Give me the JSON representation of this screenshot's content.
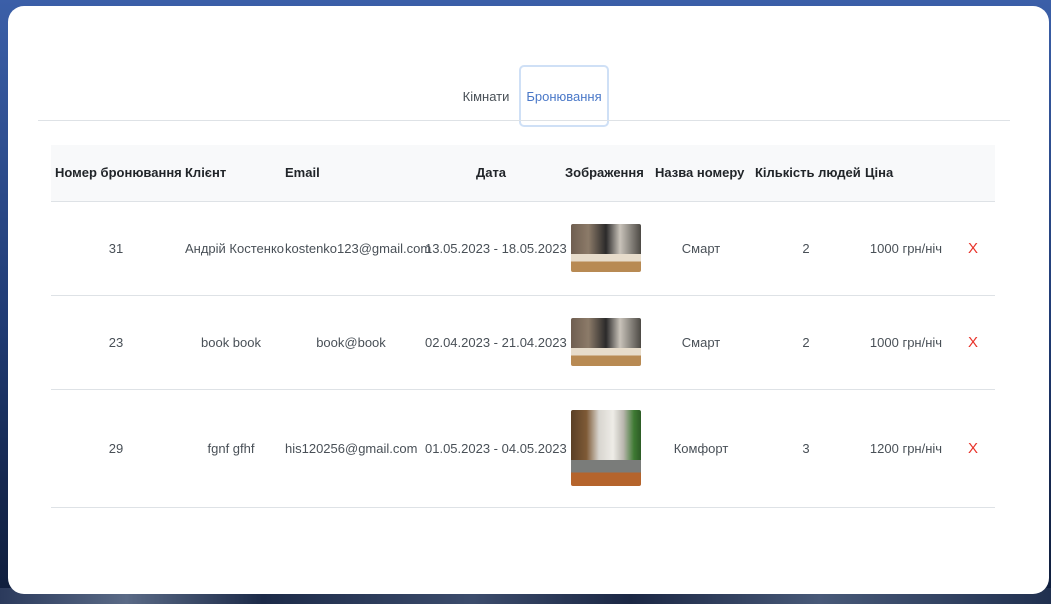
{
  "tabs": [
    {
      "label": "Кімнати",
      "active": false
    },
    {
      "label": "Бронювання",
      "active": true
    }
  ],
  "table": {
    "headers": [
      "Номер бронювання",
      "Клієнт",
      "Email",
      "Дата",
      "Зображення",
      "Назва номеру",
      "Кількість людей",
      "Ціна"
    ],
    "rows": [
      {
        "id": "31",
        "client": "Андрій Костенко",
        "email": "kostenko123@gmail.com",
        "date": "13.05.2023 - 18.05.2023",
        "room": "Смарт",
        "people": "2",
        "price": "1000 грн/ніч",
        "delete": "X"
      },
      {
        "id": "23",
        "client": "book book",
        "email": "book@book",
        "date": "02.04.2023 - 21.04.2023",
        "room": "Смарт",
        "people": "2",
        "price": "1000 грн/ніч",
        "delete": "X"
      },
      {
        "id": "29",
        "client": "fgnf gfhf",
        "email": "his120256@gmail.com",
        "date": "01.05.2023 - 04.05.2023",
        "room": "Комфорт",
        "people": "3",
        "price": "1200 грн/ніч",
        "delete": "X"
      }
    ]
  },
  "colors": {
    "accent": "#4a78c8",
    "delete": "#e8332a"
  }
}
